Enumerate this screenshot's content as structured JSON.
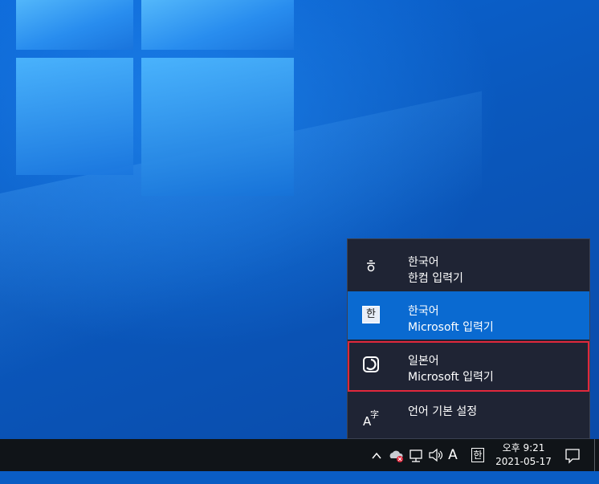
{
  "ime_menu": {
    "items": [
      {
        "language": "한국어",
        "method": "한컴 입력기",
        "icon": "hangul-ieung-icon",
        "selected": false
      },
      {
        "language": "한국어",
        "method": "Microsoft 입력기",
        "icon": "han-box-icon",
        "icon_text": "한",
        "selected": true
      },
      {
        "language": "일본어",
        "method": "Microsoft 입력기",
        "icon": "japanese-ime-icon",
        "selected": false,
        "highlighted": true
      }
    ],
    "settings": {
      "label": "언어 기본 설정",
      "icon": "language-settings-icon",
      "icon_text": "A字"
    }
  },
  "taskbar": {
    "tray": {
      "chevron": "^",
      "ime_mode": "A",
      "ime_lang": "한"
    },
    "clock": {
      "time": "오후 9:21",
      "date": "2021-05-17"
    }
  },
  "colors": {
    "menu_bg": "#1f2434",
    "selected_bg": "#0a6ad1",
    "highlight_border": "#e0283c",
    "taskbar_bg": "#101418"
  }
}
